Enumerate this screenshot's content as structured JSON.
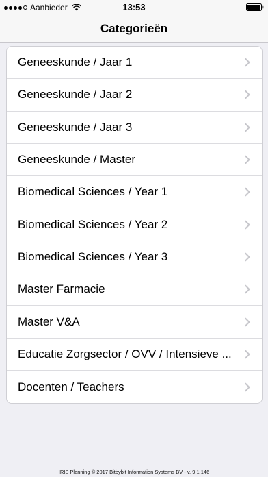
{
  "status_bar": {
    "carrier": "Aanbieder",
    "time": "13:53"
  },
  "nav": {
    "title": "Categorieën"
  },
  "categories": [
    {
      "label": "Geneeskunde / Jaar 1"
    },
    {
      "label": "Geneeskunde / Jaar 2"
    },
    {
      "label": "Geneeskunde / Jaar 3"
    },
    {
      "label": "Geneeskunde / Master"
    },
    {
      "label": "Biomedical Sciences / Year 1"
    },
    {
      "label": "Biomedical Sciences / Year 2"
    },
    {
      "label": "Biomedical Sciences / Year 3"
    },
    {
      "label": "Master Farmacie"
    },
    {
      "label": "Master V&A"
    },
    {
      "label": "Educatie Zorgsector / OVV / Intensieve ..."
    },
    {
      "label": "Docenten / Teachers"
    }
  ],
  "footer": {
    "text": "IRIS Planning © 2017 Bitbybit Information Systems BV - v. 9.1.146"
  },
  "icons": {
    "row_accessory": "chevron-right-icon",
    "wifi": "wifi-icon",
    "battery": "battery-icon"
  },
  "colors": {
    "background": "#efeff4",
    "chevron": "#c7c7cc",
    "separator": "#dcdce0"
  }
}
